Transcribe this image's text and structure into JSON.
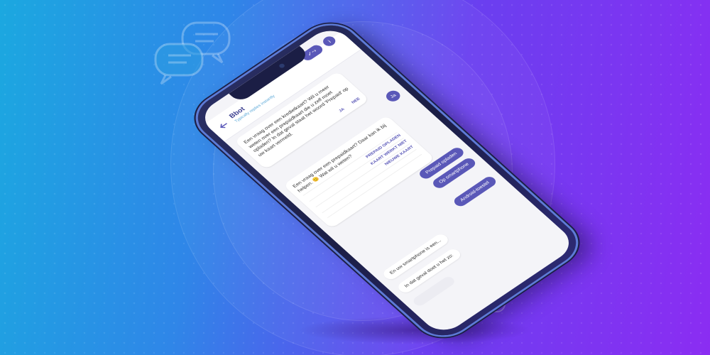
{
  "colors": {
    "accent": "#5a58b8",
    "header_name": "#3b3f8f",
    "status": "#5aa8d8"
  },
  "header": {
    "bot_name": "Bbot",
    "status": "Typically replies instantly",
    "action_icon": "check-arrows-icon",
    "info_icon": "info-icon"
  },
  "chat": {
    "card1": {
      "text": "Een vraag over een kredietkaart? Wil u meer weten over een prepaidkaart die u zelf moet opladen? In dat geval staat het woord 'Prepaid' op uw kaart vermeld.",
      "options": [
        "JA",
        "NEE"
      ]
    },
    "user_ja": "Ja",
    "card2": {
      "text": "Een vraag over een prepaidkaart? Daar kan ik bij helpen. 😊 Wat wil u weten?",
      "options": [
        "PREPAID OPLADEN",
        "KAART WERKT NIET",
        "NIEUWE KAART"
      ]
    },
    "user_prepaid": "Prepaid opladen",
    "user_smartphone": "Op smartphone",
    "user_android": "Android-toestel",
    "bot_smartphone": "En uw smartphone is een...",
    "bot_case": "In dat geval doet u het zo:"
  }
}
